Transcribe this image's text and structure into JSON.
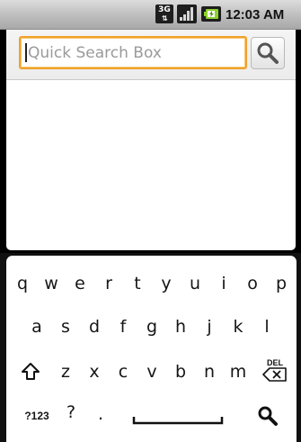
{
  "status_bar": {
    "network_type": "3G",
    "network_arrows": "⇅",
    "time": "12:03 AM"
  },
  "search": {
    "placeholder": "Quick Search Box",
    "value": "",
    "search_icon": "magnifier-icon"
  },
  "keyboard": {
    "row1": [
      "q",
      "w",
      "e",
      "r",
      "t",
      "y",
      "u",
      "i",
      "o",
      "p"
    ],
    "row2": [
      "a",
      "s",
      "d",
      "f",
      "g",
      "h",
      "j",
      "k",
      "l"
    ],
    "row3": [
      "z",
      "x",
      "c",
      "v",
      "b",
      "n",
      "m"
    ],
    "shift_icon": "shift-arrow-icon",
    "delete_label": "DEL",
    "symbols_label": "?123",
    "question_mark": "?",
    "period": ".",
    "search_key_icon": "magnifier-icon"
  }
}
